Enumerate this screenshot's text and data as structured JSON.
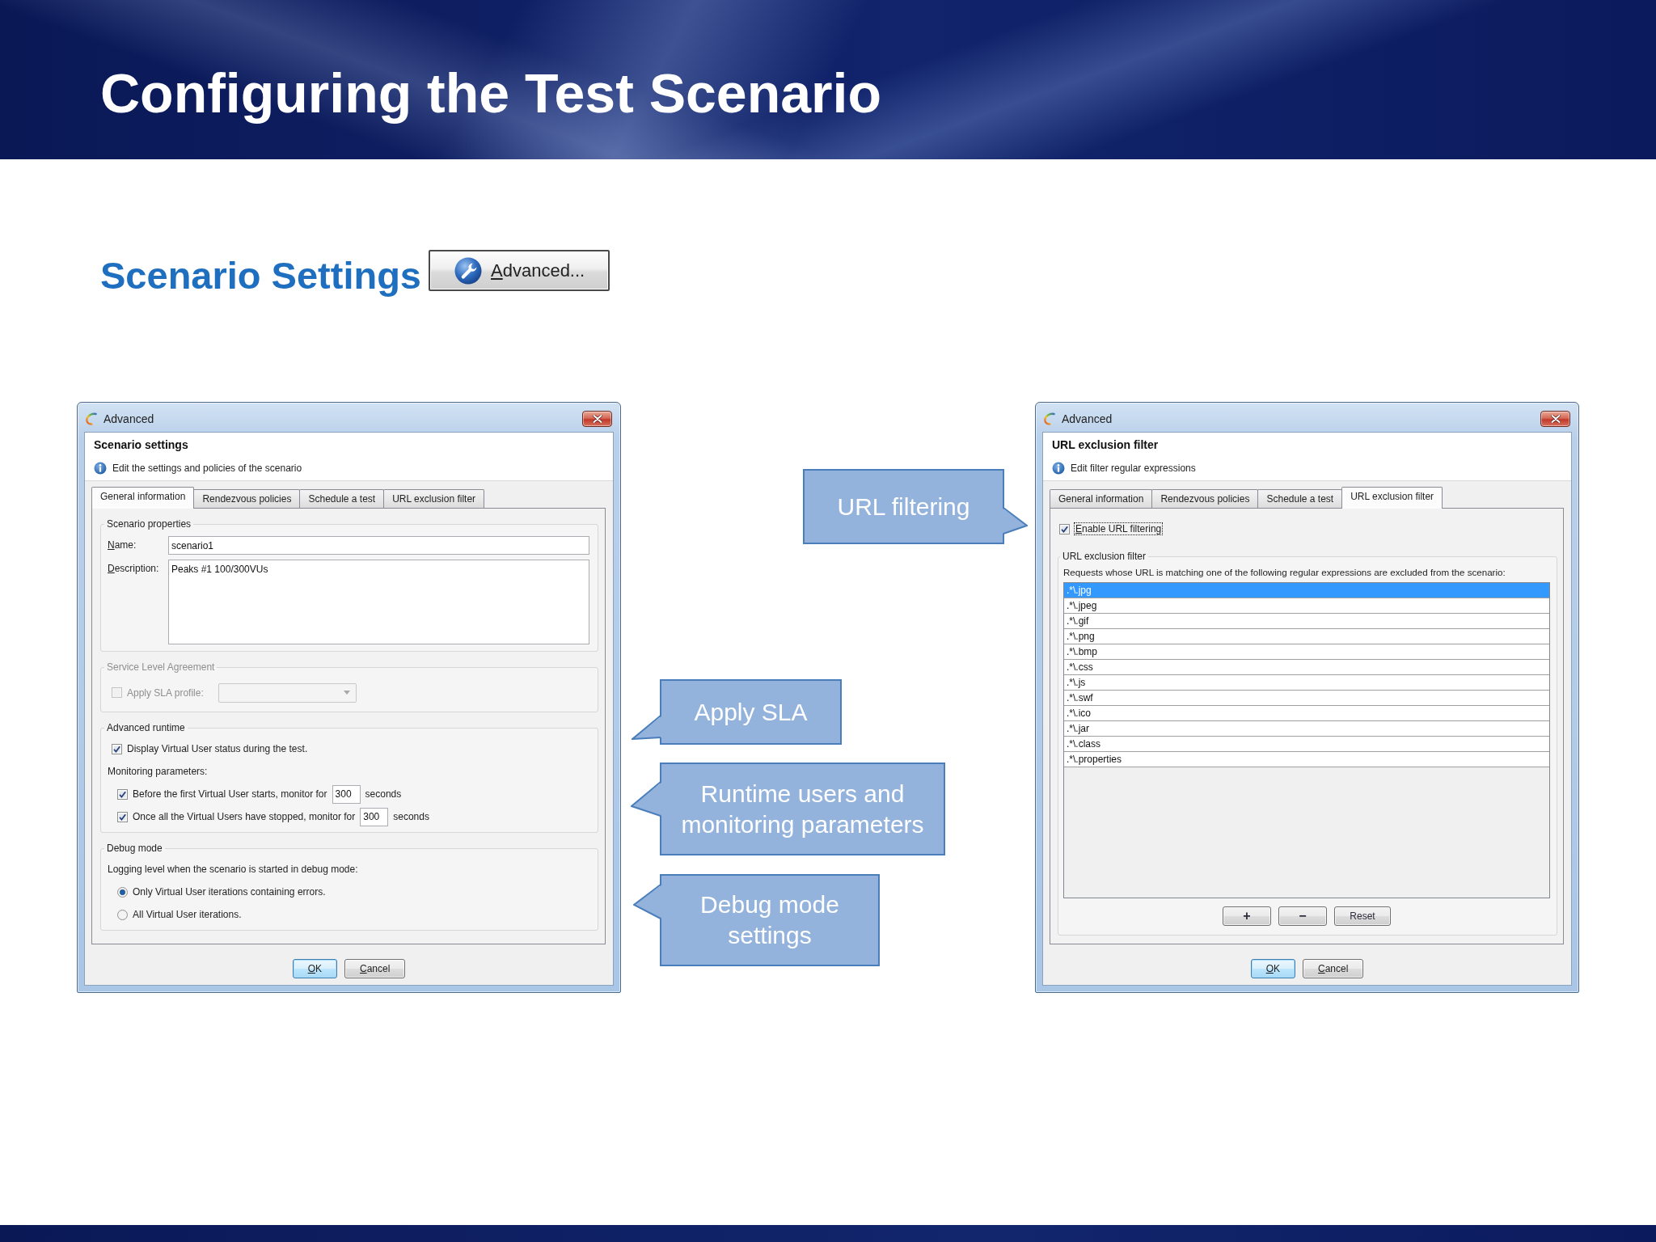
{
  "slide_title": "Configuring the Test Scenario",
  "section": {
    "title": "Scenario Settings",
    "button": {
      "label": "Advanced...",
      "mnemonic": true
    }
  },
  "dialogs": [
    {
      "window_title": "Advanced",
      "heading": "Scenario settings",
      "info": "Edit the settings and policies of the scenario",
      "tabs": [
        {
          "label": "General information",
          "selected": true
        },
        {
          "label": "Rendezvous policies",
          "selected": false
        },
        {
          "label": "Schedule a test",
          "selected": false
        },
        {
          "label": "URL exclusion filter",
          "selected": false
        }
      ],
      "panel": {
        "kind": "general",
        "groups": [
          {
            "title": "Scenario properties",
            "disabled": false,
            "rows": [
              {
                "kind": "text_field",
                "label": "Name:",
                "mnemonic": true,
                "value": "scenario1"
              },
              {
                "kind": "text_area",
                "label": "Description:",
                "mnemonic": true,
                "value": "Peaks #1 100/300VUs"
              }
            ]
          },
          {
            "title": "Service Level Agreement",
            "disabled": true,
            "rows": [
              {
                "kind": "checkbox_dropdown",
                "label": "Apply SLA profile:",
                "checked": false
              }
            ]
          },
          {
            "title": "Advanced runtime",
            "disabled": false,
            "rows": [
              {
                "kind": "checkbox",
                "label": "Display Virtual User status during the test.",
                "checked": true
              },
              {
                "kind": "text",
                "label": "Monitoring parameters:",
                "children": [
                  {
                    "kind": "checkbox_number",
                    "label": "Before the first Virtual User starts, monitor for",
                    "checked": true,
                    "value": "300",
                    "unit": "seconds"
                  },
                  {
                    "kind": "checkbox_number",
                    "label": "Once all the Virtual Users have stopped, monitor for",
                    "checked": true,
                    "value": "300",
                    "unit": "seconds"
                  }
                ]
              }
            ]
          },
          {
            "title": "Debug mode",
            "disabled": false,
            "rows": [
              {
                "kind": "text",
                "label": "Logging level when the scenario is started in debug mode:",
                "children": [
                  {
                    "kind": "radio",
                    "label": "Only Virtual User iterations containing errors.",
                    "selected": true
                  },
                  {
                    "kind": "radio",
                    "label": "All Virtual User iterations.",
                    "selected": false
                  }
                ]
              }
            ]
          }
        ]
      },
      "buttons": [
        {
          "label": "OK",
          "mnemonic": true,
          "default": true
        },
        {
          "label": "Cancel",
          "mnemonic": true,
          "default": false
        }
      ]
    },
    {
      "window_title": "Advanced",
      "heading": "URL exclusion filter",
      "info": "Edit filter regular expressions",
      "tabs": [
        {
          "label": "General information",
          "selected": false
        },
        {
          "label": "Rendezvous policies",
          "selected": false
        },
        {
          "label": "Schedule a test",
          "selected": false
        },
        {
          "label": "URL exclusion filter",
          "selected": true
        }
      ],
      "panel": {
        "kind": "url_filter",
        "enable": {
          "label": "Enable URL filtering",
          "mnemonic": true,
          "checked": true,
          "focused": true
        },
        "group": {
          "title": "URL exclusion filter",
          "description": "Requests whose URL is matching one of the following regular expressions are excluded from the scenario:",
          "patterns": [
            {
              "text": ".*\\.jpg",
              "selected": true
            },
            {
              "text": ".*\\.jpeg",
              "selected": false
            },
            {
              "text": ".*\\.gif",
              "selected": false
            },
            {
              "text": ".*\\.png",
              "selected": false
            },
            {
              "text": ".*\\.bmp",
              "selected": false
            },
            {
              "text": ".*\\.css",
              "selected": false
            },
            {
              "text": ".*\\.js",
              "selected": false
            },
            {
              "text": ".*\\.swf",
              "selected": false
            },
            {
              "text": ".*\\.ico",
              "selected": false
            },
            {
              "text": ".*\\.jar",
              "selected": false
            },
            {
              "text": ".*\\.class",
              "selected": false
            },
            {
              "text": ".*\\.properties",
              "selected": false
            }
          ],
          "actions": [
            {
              "kind": "symbol",
              "label": "+"
            },
            {
              "kind": "symbol",
              "label": "−"
            },
            {
              "kind": "text",
              "label": "Reset"
            }
          ]
        }
      },
      "buttons": [
        {
          "label": "OK",
          "mnemonic": true,
          "default": true
        },
        {
          "label": "Cancel",
          "mnemonic": true,
          "default": false
        }
      ]
    }
  ],
  "callouts": [
    {
      "text": "URL filtering"
    },
    {
      "text": "Apply SLA"
    },
    {
      "text": "Runtime users and monitoring parameters"
    },
    {
      "text": "Debug mode settings"
    }
  ]
}
